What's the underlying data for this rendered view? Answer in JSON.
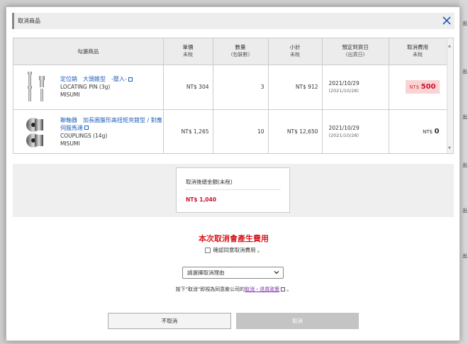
{
  "background": {
    "side_labels": [
      "出",
      "出",
      "出",
      "出",
      "出",
      "出"
    ]
  },
  "modal": {
    "title": "取消商品",
    "close_icon": "close-icon"
  },
  "table": {
    "headers": {
      "select_items": "勾選商品",
      "unit_price": "單價",
      "unit_price_sub": "未稅",
      "quantity": "數量",
      "quantity_sub": "(包裝數)",
      "subtotal": "小計",
      "subtotal_sub": "未稅",
      "ship_date": "預定到貨日",
      "ship_date_sub": "(出貨日)",
      "cancel_fee": "取消費用",
      "cancel_fee_sub": "未稅"
    },
    "rows": [
      {
        "name": "定位銷　大頭錐型　-壓入-",
        "type": "LOCATING PIN (3g)",
        "brand": "MISUMI",
        "unit_price": "NT$ 304",
        "quantity": "3",
        "subtotal": "NT$ 912",
        "date": "2021/10/29",
        "ship_date": "(2021/10/28)",
        "fee_unit": "NT$",
        "fee_value": "500"
      },
      {
        "name": "聯軸器　加長圓盤形高扭矩夾鉗型 / 對應伺服馬達",
        "type": "COUPLINGS (14g)",
        "brand": "MISUMI",
        "unit_price": "NT$ 1,265",
        "quantity": "10",
        "subtotal": "NT$ 12,650",
        "date": "2021/10/29",
        "ship_date": "(2021/10/28)",
        "fee_unit": "NT$",
        "fee_value": "0"
      }
    ]
  },
  "total": {
    "label": "取消後總金額(未稅)",
    "value": "NT$ 1,040"
  },
  "warning": {
    "title": "本次取消會產生費用",
    "agree_label": "確認同意取消費用 。"
  },
  "reason": {
    "placeholder": "請選擇取消理由"
  },
  "policy": {
    "prefix": "按下\"取消\"即視為同意敝公司的",
    "link": "取消・退貨政策",
    "suffix": " 。"
  },
  "buttons": {
    "no_cancel": "不取消",
    "cancel": "取消"
  }
}
